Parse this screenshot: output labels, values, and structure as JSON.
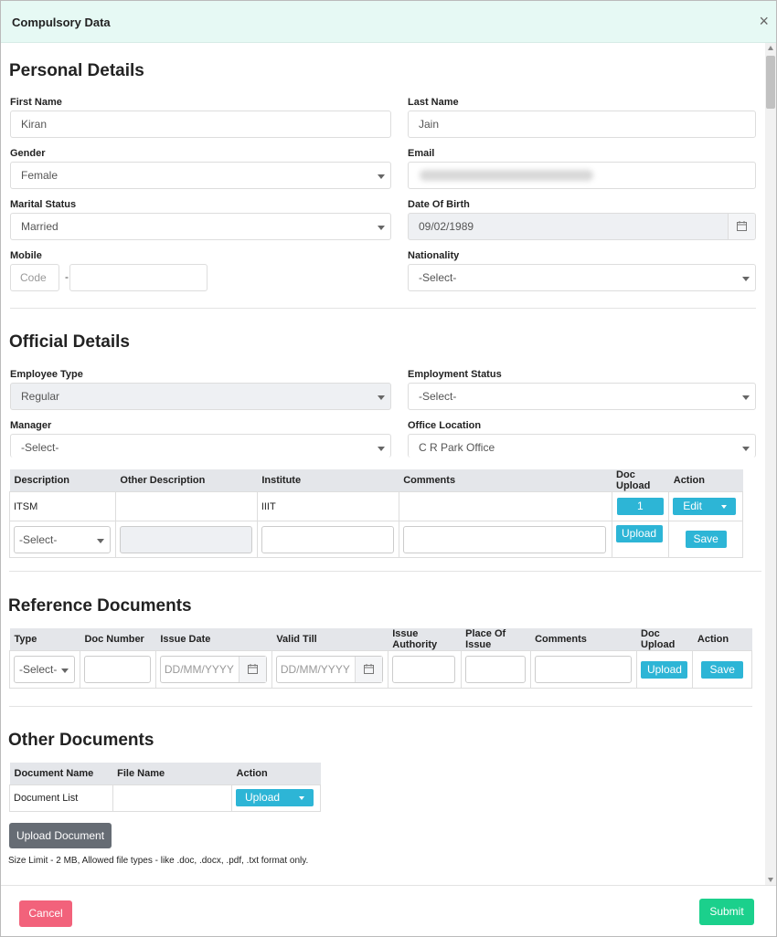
{
  "modal": {
    "title": "Compulsory Data",
    "close": "×"
  },
  "personal": {
    "heading": "Personal Details",
    "first_name": {
      "label": "First Name",
      "value": "Kiran"
    },
    "last_name": {
      "label": "Last Name",
      "value": "Jain"
    },
    "gender": {
      "label": "Gender",
      "value": "Female"
    },
    "email": {
      "label": "Email",
      "value": ""
    },
    "marital": {
      "label": "Marital Status",
      "value": "Married"
    },
    "dob": {
      "label": "Date Of Birth",
      "value": "09/02/1989"
    },
    "mobile": {
      "label": "Mobile",
      "code_placeholder": "Code",
      "dash": "-",
      "number": ""
    },
    "nationality": {
      "label": "Nationality",
      "value": "-Select-"
    }
  },
  "official": {
    "heading": "Official Details",
    "employee_type": {
      "label": "Employee Type",
      "value": "Regular"
    },
    "employment_status": {
      "label": "Employment Status",
      "value": "-Select-"
    },
    "manager": {
      "label": "Manager",
      "value": "-Select-"
    },
    "office_location": {
      "label": "Office Location",
      "value": "C R Park Office"
    }
  },
  "education_table": {
    "headers": [
      "Description",
      "Other Description",
      "Institute",
      "Comments",
      "Doc Upload",
      "Action"
    ],
    "row": {
      "description": "ITSM",
      "other": "",
      "institute": "IIIT",
      "comments": "",
      "doc_count": "1",
      "action": "Edit"
    },
    "new_row": {
      "description": "-Select-",
      "upload": "Upload",
      "save": "Save"
    }
  },
  "reference": {
    "heading": "Reference Documents",
    "headers": [
      "Type",
      "Doc Number",
      "Issue Date",
      "Valid Till",
      "Issue Authority",
      "Place Of Issue",
      "Comments",
      "Doc Upload",
      "Action"
    ],
    "row": {
      "type": "-Select-",
      "issue_date": "DD/MM/YYYY",
      "valid_till": "DD/MM/YYYY",
      "upload": "Upload",
      "save": "Save"
    }
  },
  "other": {
    "heading": "Other Documents",
    "headers": [
      "Document Name",
      "File Name",
      "Action"
    ],
    "row": {
      "name": "Document List",
      "file": "",
      "action": "Upload"
    },
    "upload_button": "Upload Document",
    "note": "Size Limit - 2 MB, Allowed file types - like .doc, .docx, .pdf, .txt format only."
  },
  "footer": {
    "cancel": "Cancel",
    "submit": "Submit"
  },
  "colors": {
    "header_bg": "#e6f9f4",
    "accent_blue": "#2db5d6",
    "submit_green": "#1bd08c",
    "cancel_pink": "#f2627b"
  }
}
